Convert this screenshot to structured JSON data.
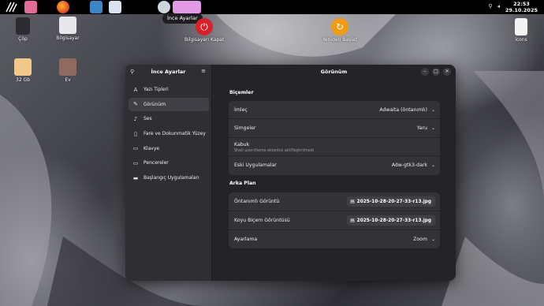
{
  "tooltip": "İnce Ayarlar",
  "clock": {
    "time": "22:53",
    "date": "29.10.2025"
  },
  "desktop": {
    "icons": [
      {
        "label": "Çöp"
      },
      {
        "label": "Bilgisayar"
      },
      {
        "label": "Bilgisayarı Kapat"
      },
      {
        "label": "Yeniden Başlat"
      },
      {
        "label": "icons"
      },
      {
        "label": "32 Gb"
      },
      {
        "label": "Ev"
      }
    ]
  },
  "window": {
    "sidebar_title": "İnce Ayarlar",
    "title": "Görünüm",
    "sidebar": {
      "items": [
        {
          "label": "Yazı Tipleri",
          "icon": "font-icon"
        },
        {
          "label": "Görünüm",
          "icon": "brush-icon"
        },
        {
          "label": "Ses",
          "icon": "music-note-icon"
        },
        {
          "label": "Fare ve Dokunmatik Yüzey",
          "icon": "mouse-icon"
        },
        {
          "label": "Klavye",
          "icon": "keyboard-icon"
        },
        {
          "label": "Pencereler",
          "icon": "monitor-icon"
        },
        {
          "label": "Başlangıç Uygulamaları",
          "icon": "folder-icon"
        }
      ]
    },
    "styles": {
      "section_title": "Biçemler",
      "cursor": {
        "label": "İmleç",
        "value": "Adwaita (öntanımlı)"
      },
      "icons": {
        "label": "Simgeler",
        "value": "Yaru"
      },
      "shell": {
        "label": "Kabuk",
        "subtitle": "Shell user-theme eklentisi aktifleştirilmedi"
      },
      "legacy": {
        "label": "Eski Uygulamalar",
        "value": "Adw-gtk3-dark"
      }
    },
    "background": {
      "section_title": "Arka Plan",
      "default_image": {
        "label": "Öntanımlı Görüntü",
        "file": "2025-10-28-20-27-33-r13.jpg"
      },
      "dark_image": {
        "label": "Koyu Biçem Görüntüsü",
        "file": "2025-10-28-20-27-33-r13.jpg"
      },
      "adjustment": {
        "label": "Ayarlama",
        "value": "Zoom"
      }
    }
  },
  "colors": {
    "window_bg": "#242428",
    "sidebar_bg": "#2e2e33",
    "row_bg": "#323237"
  }
}
